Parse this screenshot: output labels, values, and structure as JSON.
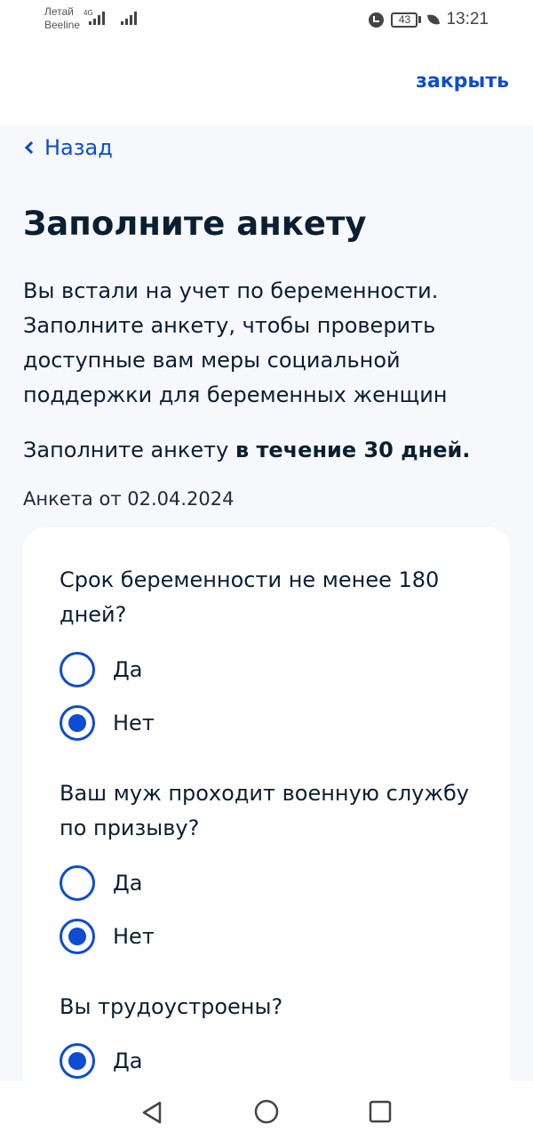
{
  "status_bar": {
    "carrier1": "Летай",
    "carrier2": "Beeline",
    "network": "4G",
    "battery": "43",
    "time": "13:21"
  },
  "topbar": {
    "close_label": "закрыть"
  },
  "nav": {
    "back_label": "Назад"
  },
  "page": {
    "title": "Заполните анкету",
    "intro": "Вы встали на учет по беременности. Заполните анкету, чтобы проверить доступные вам меры социальной поддержки для беременных женщин",
    "deadline_prefix": "Заполните анкету ",
    "deadline_bold": "в течение 30 дней.",
    "date": "Анкета от 02.04.2024"
  },
  "questions": [
    {
      "text": "Срок беременности не менее 180 дней?",
      "options": [
        {
          "label": "Да",
          "checked": false
        },
        {
          "label": "Нет",
          "checked": true
        }
      ]
    },
    {
      "text": "Ваш муж проходит военную службу по призыву?",
      "options": [
        {
          "label": "Да",
          "checked": false
        },
        {
          "label": "Нет",
          "checked": true
        }
      ]
    },
    {
      "text": "Вы трудоустроены?",
      "options": [
        {
          "label": "Да",
          "checked": true
        }
      ]
    }
  ],
  "colors": {
    "accent": "#0d4cd3",
    "text": "#0b1f33",
    "background": "#f6f8fc"
  },
  "icons": {
    "back": "chevron-left-icon",
    "nav_back": "triangle-back-icon",
    "nav_home": "circle-home-icon",
    "nav_recent": "square-recent-icon"
  }
}
